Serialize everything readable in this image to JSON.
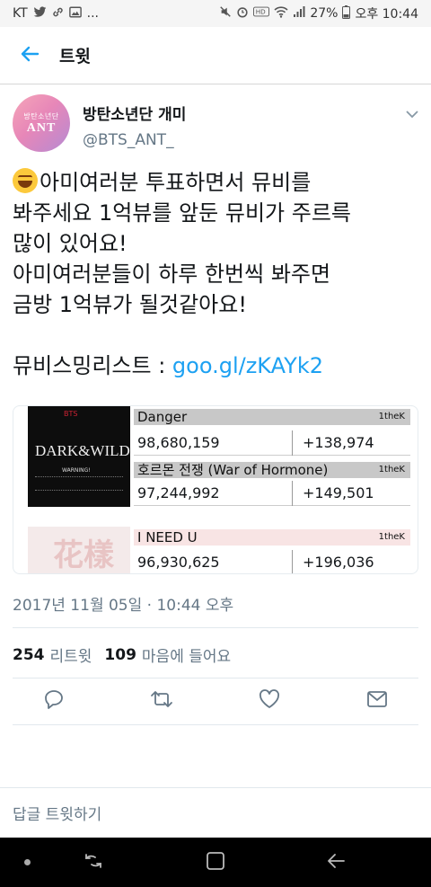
{
  "status_bar": {
    "carrier": "KT",
    "notification_icons": [
      "twitter-icon",
      "link-icon",
      "gallery-icon"
    ],
    "more": "...",
    "battery": "27%",
    "time": "오후 10:44"
  },
  "header": {
    "title": "트윗"
  },
  "tweet": {
    "display_name": "방탄소년단 개미",
    "handle": "@BTS_ANT_",
    "avatar_text_top": "방탄소년단",
    "avatar_text_main": "ANT",
    "text_lines": [
      "아미여러분 투표하면서 뮤비를",
      "봐주세요 1억뷰를 앞둔 뮤비가 주르륵",
      "많이 있어요!",
      "아미여러분들이 하루 한번씩 봐주면",
      "금방 1억뷰가 될것같아요!",
      "",
      "뮤비스밍리스트 : "
    ],
    "link_text": "goo.gl/zKAYk2",
    "date": "2017년 11월 05일 · 10:44 오후",
    "retweet_count": "254",
    "retweet_label": "리트윗",
    "like_count": "109",
    "like_label": "마음에 들어요",
    "reply_placeholder": "답글 트윗하기"
  },
  "media": {
    "album1_logo": "BTS",
    "album1_title": "DARK&WILD",
    "album1_warning": "WARNING!",
    "album2_art": "花樣",
    "rows": [
      {
        "title": "Danger",
        "source": "1theK",
        "views": "98,680,159",
        "delta": "+138,974"
      },
      {
        "title": "호르몬 전쟁 (War of Hormone)",
        "source": "1theK",
        "views": "97,244,992",
        "delta": "+149,501"
      },
      {
        "title": "I NEED U",
        "source": "1theK",
        "views": "96,930,625",
        "delta": "+196,036"
      }
    ]
  },
  "colors": {
    "accent": "#1da1f2",
    "secondary_text": "#657786",
    "primary_text": "#14171a"
  }
}
